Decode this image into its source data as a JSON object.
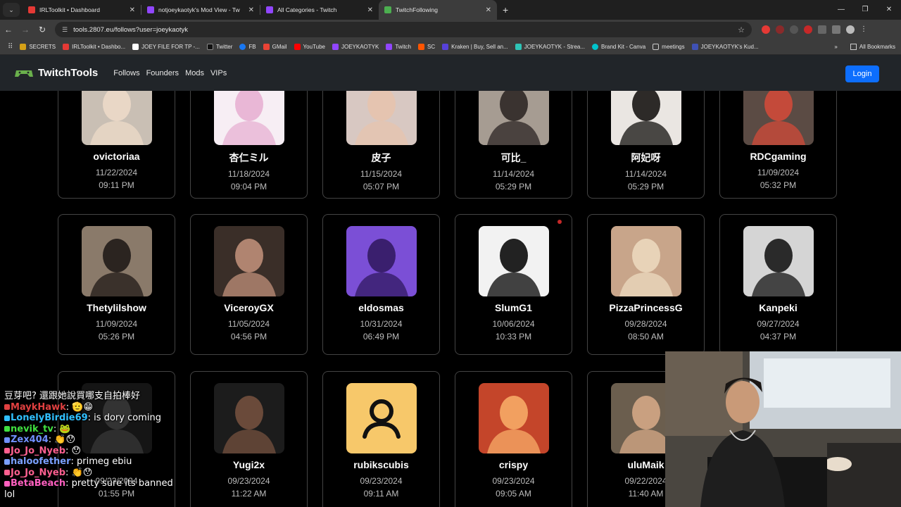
{
  "browser": {
    "tabs": [
      {
        "title": "IRLToolkit • Dashboard",
        "favicon_color": "#e53935",
        "active": false
      },
      {
        "title": "notjoeykaotyk's Mod View - Tw",
        "favicon_color": "#9146ff",
        "active": false
      },
      {
        "title": "All Categories - Twitch",
        "favicon_color": "#9146ff",
        "active": false
      },
      {
        "title": "TwitchFollowing",
        "favicon_color": "#4caf50",
        "active": true
      }
    ],
    "url": "tools.2807.eu/follows?user=joeykaotyk",
    "bookmarks": [
      "SECRETS",
      "IRLToolkit • Dashbo...",
      "JOEY FILE FOR TP -...",
      "Twitter",
      "FB",
      "GMail",
      "YouTube",
      "JOEYKAOTYK",
      "Twitch",
      "SC",
      "Kraken | Buy, Sell an...",
      "JOEYKAOTYK - Strea...",
      "Brand Kit - Canva",
      "meetings",
      "JOEYKAOTYK's Kud..."
    ],
    "all_bookmarks": "All Bookmarks"
  },
  "site": {
    "brand": "TwitchTools",
    "nav": [
      "Follows",
      "Founders",
      "Mods",
      "VIPs"
    ],
    "login": "Login"
  },
  "follows": [
    {
      "name": "ovictoriaa",
      "date": "11/22/2024",
      "time": "09:11 PM",
      "bg": "#c9bfb4",
      "fg": "#e9d7c6"
    },
    {
      "name": "杏仁ミル",
      "date": "11/18/2024",
      "time": "09:04 PM",
      "bg": "#f7eef4",
      "fg": "#e9b7d6"
    },
    {
      "name": "皮子",
      "date": "11/15/2024",
      "time": "05:07 PM",
      "bg": "#d8c8c2",
      "fg": "#e5c4b0"
    },
    {
      "name": "可比_",
      "date": "11/14/2024",
      "time": "05:29 PM",
      "bg": "#a69c92",
      "fg": "#3a3330"
    },
    {
      "name": "阿妃呀",
      "date": "11/14/2024",
      "time": "05:29 PM",
      "bg": "#eae6e2",
      "fg": "#2d2a28"
    },
    {
      "name": "RDCgaming",
      "date": "11/09/2024",
      "time": "05:32 PM",
      "bg": "#5b4b44",
      "fg": "#c44a3a"
    },
    {
      "name": "Thetylilshow",
      "date": "11/09/2024",
      "time": "05:26 PM",
      "bg": "#8a7a6a",
      "fg": "#2b2420"
    },
    {
      "name": "ViceroyGX",
      "date": "11/05/2024",
      "time": "04:56 PM",
      "bg": "#3a2e28",
      "fg": "#b08470"
    },
    {
      "name": "eldosmas",
      "date": "10/31/2024",
      "time": "06:49 PM",
      "bg": "#7b4fd6",
      "fg": "#3a1f6e"
    },
    {
      "name": "SlumG1",
      "date": "10/06/2024",
      "time": "10:33 PM",
      "bg": "#f2f2f2",
      "fg": "#222222"
    },
    {
      "name": "PizzaPrincessG",
      "date": "09/28/2024",
      "time": "08:50 AM",
      "bg": "#c8a58a",
      "fg": "#e8d3b8"
    },
    {
      "name": "Kanpeki",
      "date": "09/27/2024",
      "time": "04:37 PM",
      "bg": "#d5d5d5",
      "fg": "#2a2a2a"
    },
    {
      "name": "",
      "date": "09/23/2024",
      "time": "01:55 PM",
      "bg": "#151515",
      "fg": "#333333"
    },
    {
      "name": "Yugi2x",
      "date": "09/23/2024",
      "time": "11:22 AM",
      "bg": "#1c1c1c",
      "fg": "#6a4a3a"
    },
    {
      "name": "rubikscubis",
      "date": "09/23/2024",
      "time": "09:11 AM",
      "bg": "#f7c86a",
      "fg": "#111111"
    },
    {
      "name": "crispy",
      "date": "09/23/2024",
      "time": "09:05 AM",
      "bg": "#c4452a",
      "fg": "#f2a060"
    },
    {
      "name": "uluMaik",
      "date": "09/22/2024",
      "time": "11:40 AM",
      "bg": "#6b5e4e",
      "fg": "#c9a080"
    }
  ],
  "chat": [
    {
      "user": "",
      "color": "#ffffff",
      "msg": "豆芽吧? 還跟她說買哪支自拍棒好"
    },
    {
      "user": "MaykHawk",
      "color": "#e04040",
      "msg": ": 🫡😁"
    },
    {
      "user": "LonelyBirdie69",
      "color": "#30c0ff",
      "msg": ": is dory coming"
    },
    {
      "user": "nevik_tv",
      "color": "#40e040",
      "msg": ": 🐸"
    },
    {
      "user": "Zex404",
      "color": "#7090ff",
      "msg": ": 👏😯"
    },
    {
      "user": "Jo_Jo_Nyeb",
      "color": "#ff6090",
      "msg": ": 😯"
    },
    {
      "user": "haloofether",
      "color": "#7aa0ff",
      "msg": ": primeg ebiu"
    },
    {
      "user": "Jo_Jo_Nyeb",
      "color": "#ff6090",
      "msg": ": 👏😯"
    },
    {
      "user": "BetaBeach",
      "color": "#ff60c0",
      "msg": ": pretty sure its banned"
    },
    {
      "user": "",
      "color": "#ffffff",
      "msg": "lol"
    }
  ],
  "colors": {
    "accent": "#0d6efd",
    "header_bg": "#212529"
  }
}
